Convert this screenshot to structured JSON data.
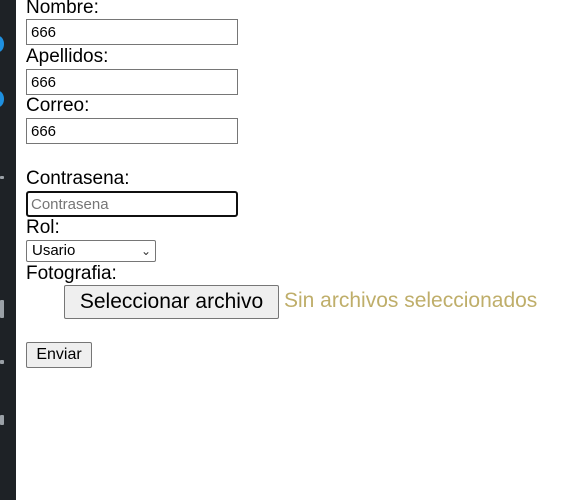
{
  "form": {
    "nombre_label": "Nombre:",
    "nombre_value": "666",
    "apellidos_label": "Apellidos:",
    "apellidos_value": "666",
    "correo_label": "Correo:",
    "correo_value": "666",
    "contrasena_label": "Contrasena:",
    "contrasena_placeholder": "Contrasena",
    "rol_label": "Rol:",
    "rol_selected": "Usario",
    "fotografia_label": "Fotografia:",
    "file_button_label": "Seleccionar archivo",
    "file_status": "Sin archivos seleccionados",
    "submit_label": "Enviar"
  },
  "colors": {
    "sidebar_bg": "#1e2226",
    "sidebar_accent": "#1e90e0",
    "file_status_text": "#bfae6a"
  },
  "icons": [
    "chevron-down-icon"
  ]
}
